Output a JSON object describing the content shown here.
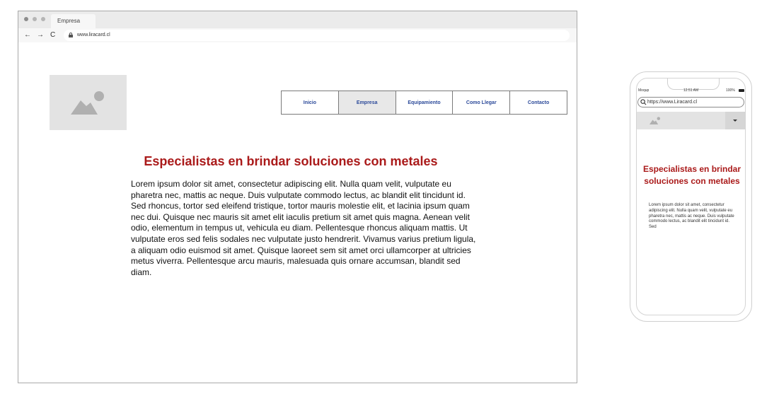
{
  "desktop": {
    "tab_title": "Empresa",
    "url": "www.liracard.cl",
    "nav_icons": [
      "back-arrow-icon",
      "forward-arrow-icon",
      "reload-icon",
      "lock-icon"
    ],
    "nav": {
      "items": [
        {
          "label": "Inicio"
        },
        {
          "label": "Empresa"
        },
        {
          "label": "Equipamiento"
        },
        {
          "label": "Como Llegar"
        },
        {
          "label": "Contacto"
        }
      ],
      "active": "Empresa"
    },
    "heading": "Especialistas en brindar soluciones con metales",
    "body": "Lorem ipsum dolor sit amet, consectetur adipiscing elit. Nulla quam velit, vulputate eu pharetra nec, mattis ac neque. Duis vulputate commodo lectus, ac blandit elit tincidunt id. Sed rhoncus, tortor sed eleifend tristique, tortor mauris molestie elit, et lacinia ipsum quam nec dui. Quisque nec mauris sit amet elit iaculis pretium sit amet quis magna. Aenean velit odio, elementum in tempus ut, vehicula eu diam. Pellentesque rhoncus aliquam mattis. Ut vulputate eros sed felis sodales nec vulputate justo hendrerit. Vivamus varius pretium ligula, a aliquam odio euismod sit amet. Quisque laoreet sem sit amet orci ullamcorper at ultricies metus viverra. Pellentesque arcu mauris, malesuada quis ornare accumsan, blandit sed diam."
  },
  "mobile": {
    "status": {
      "carrier": "Moqup",
      "time": "12:51 AM",
      "battery": "100%"
    },
    "url": "https://www.Liracard.cl",
    "heading": "Especialistas en brindar soluciones con metales",
    "body": "Lorem ipsum dolor sit amet, consectetur adipiscing elit. Nulla quam velit, vulputate eu pharetra nec, mattis ac neque. Duis vulputate commodo lectus, ac blandit elit tincidunt id. Sed"
  },
  "colors": {
    "heading": "#aa1a1a",
    "nav_text": "#2c4a9a",
    "placeholder": "#e3e3e3",
    "placeholder_icon": "#b0b0b0"
  }
}
